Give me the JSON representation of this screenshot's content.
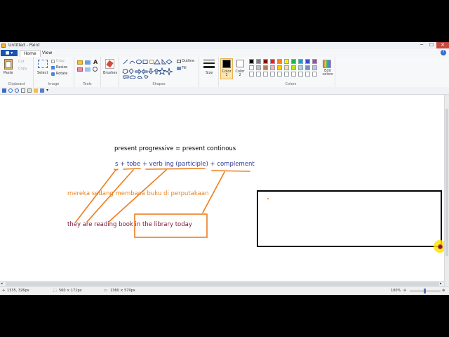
{
  "window": {
    "title": "Untitled - Paint"
  },
  "window_controls": {
    "minimize": "─",
    "maximize": "☐",
    "close": "✕"
  },
  "menu": {
    "file_label": "■ ▾",
    "tabs": [
      "Home",
      "View"
    ],
    "help": "?"
  },
  "ribbon": {
    "groups": {
      "clipboard": "Clipboard",
      "image": "Image",
      "tools": "Tools",
      "shapes": "Shapes",
      "colors": "Colors"
    },
    "paste": "Paste",
    "cut": "Cut",
    "copy": "Copy",
    "select": "Select",
    "crop": "Crop",
    "resize": "Resize",
    "rotate": "Rotate",
    "text_tool": "A",
    "brushes": "Brushes",
    "outline": "Outline",
    "fill": "Fill",
    "size": "Size",
    "color1": "Color 1",
    "color2": "Color 2",
    "edit_colors": "Edit colors",
    "palette_top": [
      "#000000",
      "#7f7f7f",
      "#880015",
      "#ed1c24",
      "#ff7f27",
      "#fff200",
      "#22b14c",
      "#00a2e8",
      "#3f48cc",
      "#a349a4"
    ],
    "palette_bottom": [
      "#ffffff",
      "#c3c3c3",
      "#b97a57",
      "#ffaec9",
      "#ffc90e",
      "#efe4b0",
      "#b5e61d",
      "#99d9ea",
      "#7092be",
      "#c8bfe7"
    ],
    "palette_blank": [
      "#ffffff",
      "#ffffff",
      "#ffffff",
      "#ffffff",
      "#ffffff",
      "#ffffff",
      "#ffffff",
      "#ffffff",
      "#ffffff",
      "#ffffff"
    ],
    "color1_value": "#000000",
    "color2_value": "#ffffff"
  },
  "canvas": {
    "heading": "present progressive = present continous",
    "formula": "s + tobe + verb ing (participle) + complement",
    "indonesian": "mereka sedang membaca buku di perputakaan",
    "english_start": "they are reading book ",
    "english_boxed": "in the library today",
    "colors": {
      "heading": "#000000",
      "formula": "#2f3a8f",
      "indonesian": "#e8841f",
      "english": "#7a1530",
      "orange": "#ed7d1e",
      "box": "#000000"
    }
  },
  "status": {
    "cursor_pos": "1335, 326px",
    "selection_size": "560 × 171px",
    "image_size": "1360 × 570px",
    "zoom": "100%"
  }
}
